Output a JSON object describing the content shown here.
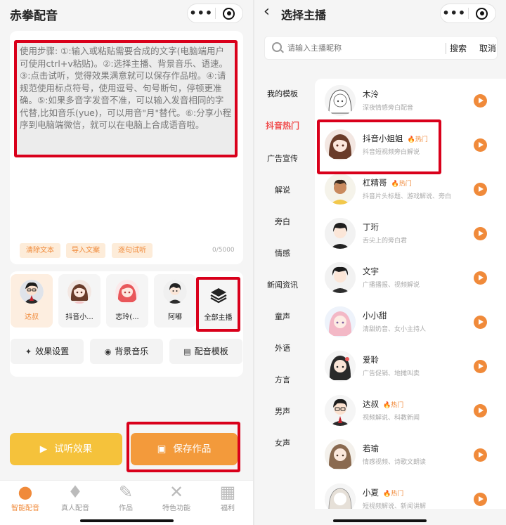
{
  "left": {
    "title": "赤拳配音",
    "capsule_dots": "•••",
    "instructions": "使用步骤: ①:输入或粘贴需要合成的文字(电脑端用户可使用ctrl+v粘贴)。②:选择主播、背景音乐、语速。③:点击试听，觉得效果满意就可以保存作品啦。④:请规范使用标点符号，使用逗号、句号断句，停顿更准确。⑤:如果多音字发音不准，可以输入发音相同的字代替,比如音乐(yue)，可以用音\"月\"替代。⑥:分享小程序到电脑端微信，就可以在电脑上合成语音啦。",
    "clear_text": "清除文本",
    "import_text": "导入文案",
    "sentence_preview": "逐句试听",
    "char_counter": "0/5000",
    "anchors": [
      {
        "name": "达叔",
        "avatar": "avatar-dashu-icon"
      },
      {
        "name": "抖音小...",
        "avatar": "avatar-douyin-icon"
      },
      {
        "name": "志玲(...",
        "avatar": "avatar-zhiling-icon"
      },
      {
        "name": "阿嘟",
        "avatar": "avatar-adu-icon"
      }
    ],
    "all_anchors": "全部主播",
    "effects": "效果设置",
    "bgm": "背景音乐",
    "template": "配音模板",
    "preview": "试听效果",
    "save": "保存作品",
    "tabs": [
      "智能配音",
      "真人配音",
      "作品",
      "特色功能",
      "福利"
    ],
    "accent": "#f08a3a"
  },
  "right": {
    "title": "选择主播",
    "search_placeholder": "请输入主播昵称",
    "search_btn": "搜索",
    "cancel_btn": "取消",
    "categories": [
      "我的模板",
      "抖音热门",
      "广告宣传",
      "解说",
      "旁白",
      "情感",
      "新闻资讯",
      "童声",
      "外语",
      "方言",
      "男声",
      "女声"
    ],
    "active_category": "抖音热门",
    "hot_label": "热门",
    "anchors": [
      {
        "name": "木泠",
        "desc": "深夜情感旁白配音",
        "hot": false
      },
      {
        "name": "抖音小姐姐",
        "desc": "抖音短视频旁白解说",
        "hot": true
      },
      {
        "name": "杠精哥",
        "desc": "抖音片头标题、游戏解说、旁白",
        "hot": true
      },
      {
        "name": "丁珩",
        "desc": "舌尖上的旁白君",
        "hot": false
      },
      {
        "name": "文宇",
        "desc": "广播播报、视频解说",
        "hot": false
      },
      {
        "name": "小小甜",
        "desc": "清甜奶音、女小主持人",
        "hot": false
      },
      {
        "name": "爱聆",
        "desc": "广告促销、地摊叫卖",
        "hot": false
      },
      {
        "name": "达叔",
        "desc": "视频解说、科教新闻",
        "hot": true
      },
      {
        "name": "若瑜",
        "desc": "情感视频、诗歌文朗读",
        "hot": false
      },
      {
        "name": "小夏",
        "desc": "短视频解说、新闻讲解",
        "hot": true
      }
    ]
  }
}
